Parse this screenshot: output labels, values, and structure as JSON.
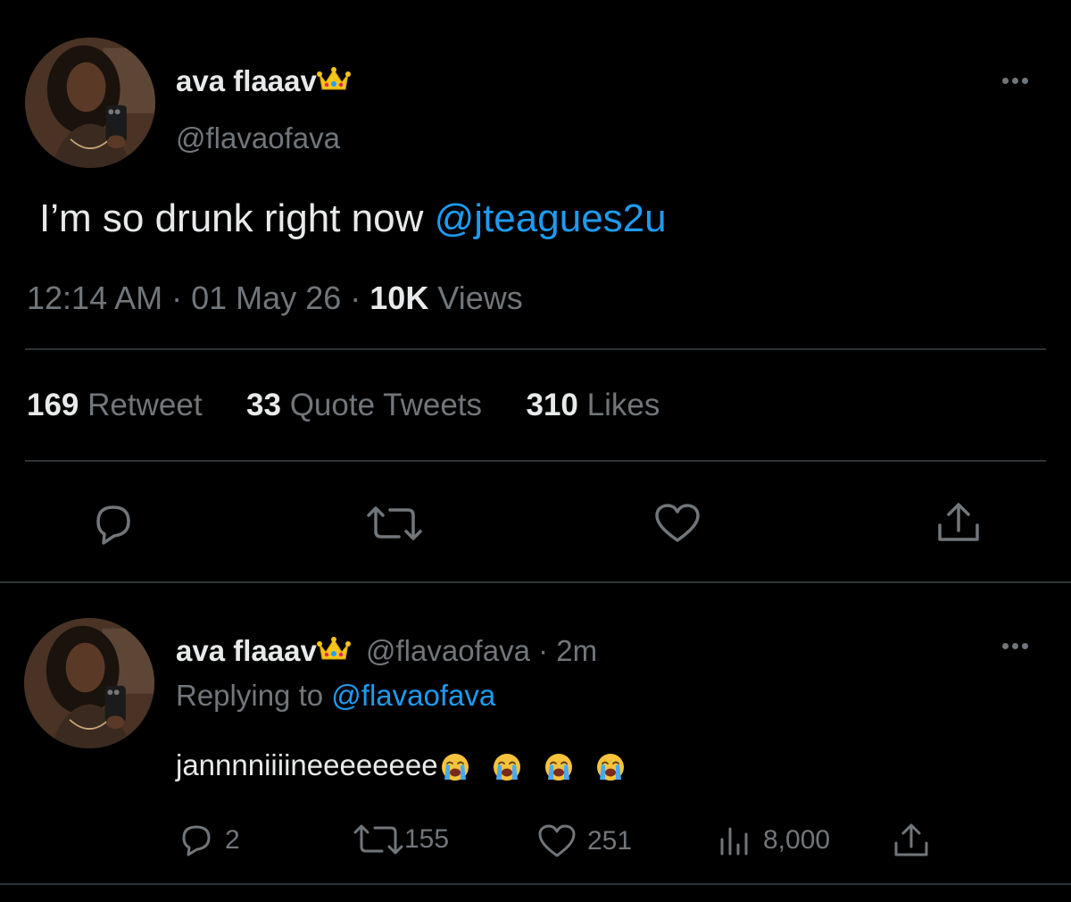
{
  "tweet": {
    "author": {
      "display_name": "ava flaaav",
      "handle": "@flavaofava"
    },
    "text": "I’m so drunk right now",
    "mention": "@jteagues2u",
    "time": "12:14 AM",
    "date": "01 May 26",
    "views_count": "10K",
    "views_label": "Views",
    "dot": "·",
    "stats": {
      "retweets_count": "169",
      "retweets_label": "Retweet",
      "quotes_count": "33",
      "quotes_label": "Quote Tweets",
      "likes_count": "310",
      "likes_label": "Likes"
    },
    "actions": [
      "reply-icon",
      "retweet-icon",
      "like-icon",
      "share-icon"
    ]
  },
  "reply": {
    "author": {
      "display_name": "ava flaaav",
      "handle": "@flavaofava"
    },
    "dot": "·",
    "age": "2m",
    "replying_prefix": "Replying to",
    "replying_to": "@flavaofava",
    "text": "jannnniiiineeeeeeee",
    "emoji_count": 4,
    "metrics": {
      "replies": "2",
      "retweets": "155",
      "likes": "251",
      "views": "8,000"
    }
  },
  "colors": {
    "background": "#000000",
    "text": "#e7e9ea",
    "muted": "#71767b",
    "link": "#1d9bf0",
    "divider": "#2f3336"
  }
}
